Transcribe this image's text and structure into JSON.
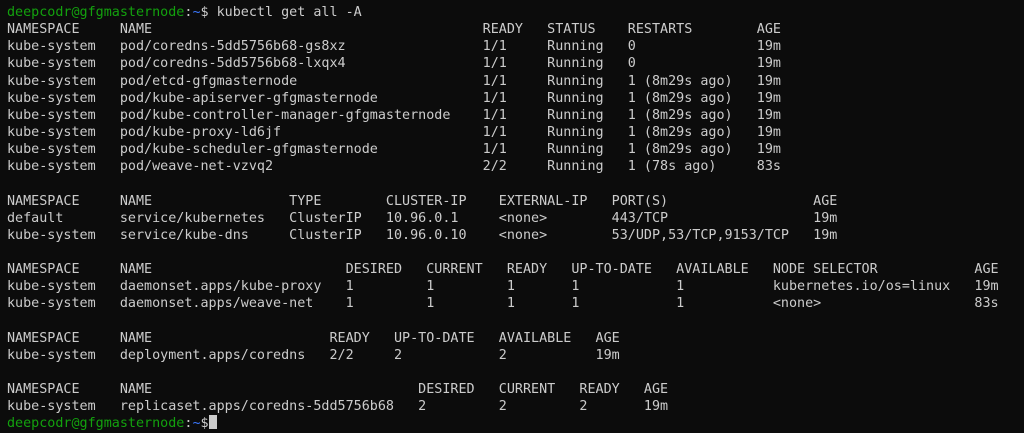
{
  "prompt": {
    "user_host": "deepcodr@gfgmasternode",
    "sep": ":",
    "path": "~",
    "symbol": "$"
  },
  "command": "kubectl get all -A",
  "lines": [
    "NAMESPACE     NAME                                         READY   STATUS    RESTARTS        AGE",
    "kube-system   pod/coredns-5dd5756b68-gs8xz                 1/1     Running   0               19m",
    "kube-system   pod/coredns-5dd5756b68-lxqx4                 1/1     Running   0               19m",
    "kube-system   pod/etcd-gfgmasternode                       1/1     Running   1 (8m29s ago)   19m",
    "kube-system   pod/kube-apiserver-gfgmasternode             1/1     Running   1 (8m29s ago)   19m",
    "kube-system   pod/kube-controller-manager-gfgmasternode    1/1     Running   1 (8m29s ago)   19m",
    "kube-system   pod/kube-proxy-ld6jf                         1/1     Running   1 (8m29s ago)   19m",
    "kube-system   pod/kube-scheduler-gfgmasternode             1/1     Running   1 (8m29s ago)   19m",
    "kube-system   pod/weave-net-vzvq2                          2/2     Running   1 (78s ago)     83s",
    "",
    "NAMESPACE     NAME                 TYPE        CLUSTER-IP    EXTERNAL-IP   PORT(S)                  AGE",
    "default       service/kubernetes   ClusterIP   10.96.0.1     <none>        443/TCP                  19m",
    "kube-system   service/kube-dns     ClusterIP   10.96.0.10    <none>        53/UDP,53/TCP,9153/TCP   19m",
    "",
    "NAMESPACE     NAME                        DESIRED   CURRENT   READY   UP-TO-DATE   AVAILABLE   NODE SELECTOR            AGE",
    "kube-system   daemonset.apps/kube-proxy   1         1         1       1            1           kubernetes.io/os=linux   19m",
    "kube-system   daemonset.apps/weave-net    1         1         1       1            1           <none>                   83s",
    "",
    "NAMESPACE     NAME                      READY   UP-TO-DATE   AVAILABLE   AGE",
    "kube-system   deployment.apps/coredns   2/2     2            2           19m",
    "",
    "NAMESPACE     NAME                                 DESIRED   CURRENT   READY   AGE",
    "kube-system   replicaset.apps/coredns-5dd5756b68   2         2         2       19m"
  ]
}
